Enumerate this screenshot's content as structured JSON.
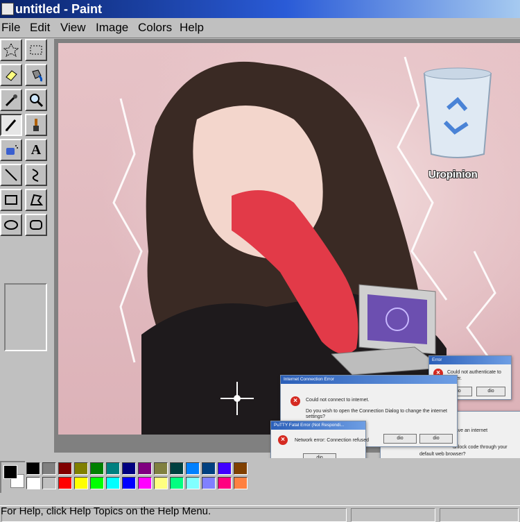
{
  "window": {
    "title": "untitled - Paint"
  },
  "menu": [
    "File",
    "Edit",
    "View",
    "Image",
    "Colors",
    "Help"
  ],
  "tools": [
    "free-select-icon",
    "rect-select-icon",
    "eraser-icon",
    "fill-bucket-icon",
    "color-picker-icon",
    "magnifier-icon",
    "pencil-icon",
    "brush-icon",
    "airbrush-icon",
    "text-icon",
    "line-icon",
    "curve-icon",
    "rectangle-icon",
    "polygon-icon",
    "ellipse-icon",
    "rounded-rect-icon"
  ],
  "active_tool": "pencil-icon",
  "palette": {
    "foreground": "#000000",
    "background": "#ffffff",
    "top_row": [
      "#000000",
      "#808080",
      "#800000",
      "#808000",
      "#008000",
      "#008080",
      "#000080",
      "#800080",
      "#808040",
      "#004040",
      "#0080ff",
      "#004080",
      "#4000ff",
      "#804000"
    ],
    "bottom_row": [
      "#ffffff",
      "#c0c0c0",
      "#ff0000",
      "#ffff00",
      "#00ff00",
      "#00ffff",
      "#0000ff",
      "#ff00ff",
      "#ffff80",
      "#00ff80",
      "#80ffff",
      "#8080ff",
      "#ff0080",
      "#ff8040"
    ]
  },
  "status": {
    "help_text": "For Help, click Help Topics on the Help Menu."
  },
  "desktop_icon": {
    "label": "Uropinion",
    "icon": "recycle-bin-icon"
  },
  "dialogs": {
    "internet_error": {
      "title": "Internet Connection Error",
      "line1": "Could not connect to internet.",
      "line2": "Do you wish to open the Connection Dialog to change the internet",
      "line3": "settings?",
      "button_ok": "dio",
      "button_cancel": "dio"
    },
    "putty_error": {
      "title": "PuTTY Fatal Error (Not Respondi...",
      "message": "Network error: Connection refused",
      "button": "dio"
    },
    "auth_error": {
      "title": "Error",
      "line1": "Could not authenticate to",
      "line2": "server.",
      "button_ok": "dio",
      "button_cancel": "dio"
    },
    "browser_error": {
      "line1": "make sure you have an internet",
      "line2": "unlock code through your",
      "line3": "default web browser?",
      "button_ok": "dio",
      "button_cancel": "dio"
    }
  }
}
